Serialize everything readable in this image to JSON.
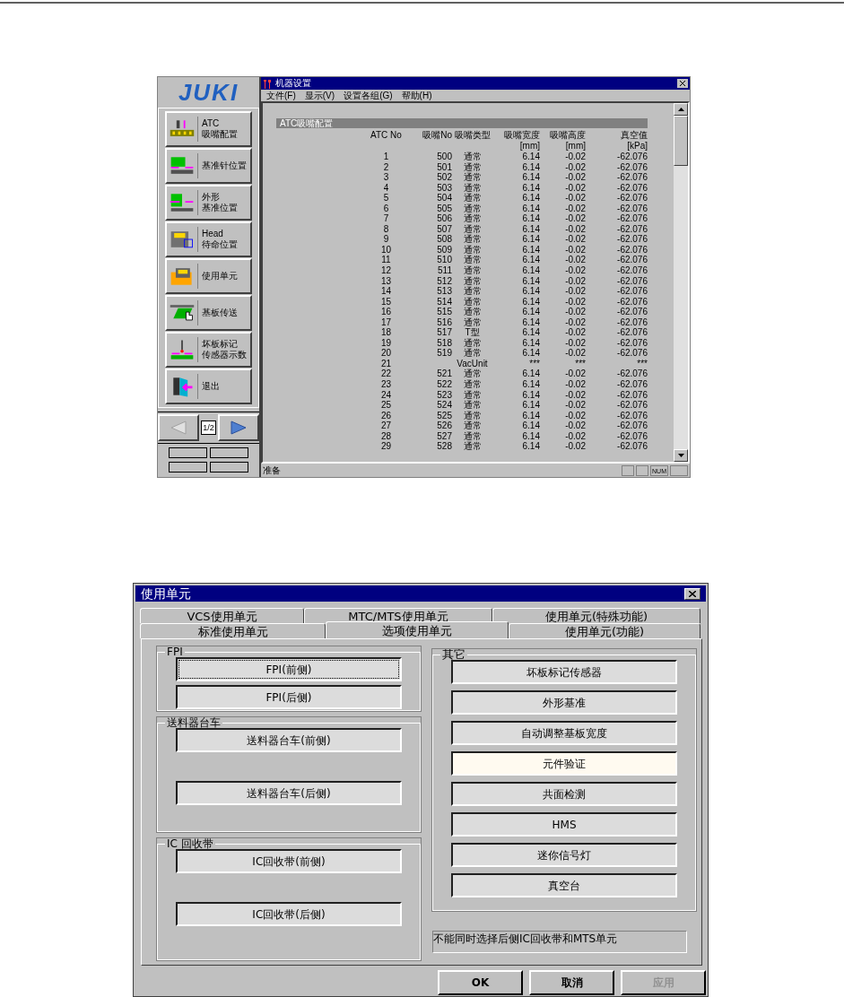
{
  "machine_window": {
    "sidebar": {
      "logo": "JUKI",
      "buttons": [
        {
          "kind": "atc",
          "lines": [
            "ATC",
            "吸嘴配置"
          ]
        },
        {
          "kind": "pin",
          "lines": [
            "基准针位置"
          ]
        },
        {
          "kind": "outline",
          "lines": [
            "外形",
            "基准位置"
          ]
        },
        {
          "kind": "head",
          "lines": [
            "Head",
            "待命位置"
          ]
        },
        {
          "kind": "unit",
          "lines": [
            "使用单元"
          ]
        },
        {
          "kind": "transfer",
          "lines": [
            "基板传送"
          ]
        },
        {
          "kind": "badmark",
          "lines": [
            "坏板标记",
            "传感器示数"
          ]
        },
        {
          "kind": "exit",
          "lines": [
            "退出"
          ]
        }
      ],
      "nav": {
        "prev_disabled": true,
        "page": "1/2",
        "next_disabled": false
      }
    },
    "title": "机器设置",
    "menu": [
      "文件(F)",
      "显示(V)",
      "设置各组(G)",
      "帮助(H)"
    ],
    "section": "ATC吸嘴配置",
    "columns": [
      "ATC No",
      "吸嘴No",
      "吸嘴类型",
      "吸嘴宽度",
      "吸嘴高度",
      "真空值"
    ],
    "units": [
      "[mm]",
      "[mm]",
      "[kPa]"
    ],
    "rows": [
      [
        "1",
        "500",
        "通常",
        "6.14",
        "-0.02",
        "-62.076"
      ],
      [
        "2",
        "501",
        "通常",
        "6.14",
        "-0.02",
        "-62.076"
      ],
      [
        "3",
        "502",
        "通常",
        "6.14",
        "-0.02",
        "-62.076"
      ],
      [
        "4",
        "503",
        "通常",
        "6.14",
        "-0.02",
        "-62.076"
      ],
      [
        "5",
        "504",
        "通常",
        "6.14",
        "-0.02",
        "-62.076"
      ],
      [
        "6",
        "505",
        "通常",
        "6.14",
        "-0.02",
        "-62.076"
      ],
      [
        "7",
        "506",
        "通常",
        "6.14",
        "-0.02",
        "-62.076"
      ],
      [
        "8",
        "507",
        "通常",
        "6.14",
        "-0.02",
        "-62.076"
      ],
      [
        "9",
        "508",
        "通常",
        "6.14",
        "-0.02",
        "-62.076"
      ],
      [
        "10",
        "509",
        "通常",
        "6.14",
        "-0.02",
        "-62.076"
      ],
      [
        "11",
        "510",
        "通常",
        "6.14",
        "-0.02",
        "-62.076"
      ],
      [
        "12",
        "511",
        "通常",
        "6.14",
        "-0.02",
        "-62.076"
      ],
      [
        "13",
        "512",
        "通常",
        "6.14",
        "-0.02",
        "-62.076"
      ],
      [
        "14",
        "513",
        "通常",
        "6.14",
        "-0.02",
        "-62.076"
      ],
      [
        "15",
        "514",
        "通常",
        "6.14",
        "-0.02",
        "-62.076"
      ],
      [
        "16",
        "515",
        "通常",
        "6.14",
        "-0.02",
        "-62.076"
      ],
      [
        "17",
        "516",
        "通常",
        "6.14",
        "-0.02",
        "-62.076"
      ],
      [
        "18",
        "517",
        "T型",
        "6.14",
        "-0.02",
        "-62.076"
      ],
      [
        "19",
        "518",
        "通常",
        "6.14",
        "-0.02",
        "-62.076"
      ],
      [
        "20",
        "519",
        "通常",
        "6.14",
        "-0.02",
        "-62.076"
      ],
      [
        "21",
        null,
        "VacUnit",
        "***",
        "***",
        "***"
      ],
      [
        "22",
        "521",
        "通常",
        "6.14",
        "-0.02",
        "-62.076"
      ],
      [
        "23",
        "522",
        "通常",
        "6.14",
        "-0.02",
        "-62.076"
      ],
      [
        "24",
        "523",
        "通常",
        "6.14",
        "-0.02",
        "-62.076"
      ],
      [
        "25",
        "524",
        "通常",
        "6.14",
        "-0.02",
        "-62.076"
      ],
      [
        "26",
        "525",
        "通常",
        "6.14",
        "-0.02",
        "-62.076"
      ],
      [
        "27",
        "526",
        "通常",
        "6.14",
        "-0.02",
        "-62.076"
      ],
      [
        "28",
        "527",
        "通常",
        "6.14",
        "-0.02",
        "-62.076"
      ],
      [
        "29",
        "528",
        "通常",
        "6.14",
        "-0.02",
        "-62.076"
      ]
    ],
    "status_bar": {
      "text": "准备",
      "indicator": "NUM"
    }
  },
  "unit_dialog": {
    "title": "使用单元",
    "tabs_back": [
      {
        "label": "VCS使用单元",
        "selected": false
      },
      {
        "label": "MTC/MTS使用单元",
        "selected": false
      },
      {
        "label": "使用单元(特殊功能)",
        "selected": false
      }
    ],
    "tabs_front": [
      {
        "label": "标准使用单元",
        "selected": false
      },
      {
        "label": "选项使用单元",
        "selected": true
      },
      {
        "label": "使用单元(功能)",
        "selected": false
      }
    ],
    "left_groups": [
      {
        "title": "FPI",
        "buttons": [
          {
            "label": "FPI(前侧)",
            "focused": true
          },
          {
            "label": "FPI(后侧)",
            "focused": false
          }
        ]
      },
      {
        "title": "送料器台车",
        "buttons": [
          {
            "label": "送料器台车(前侧)",
            "focused": false
          },
          {
            "label": "送料器台车(后侧)",
            "focused": false
          }
        ]
      },
      {
        "title": "IC 回收带",
        "buttons": [
          {
            "label": "IC回收带(前侧)",
            "focused": false
          },
          {
            "label": "IC回收带(后侧)",
            "focused": false
          }
        ]
      }
    ],
    "other_group": {
      "title": "其它",
      "buttons": [
        {
          "label": "坏板标记传感器",
          "on": false
        },
        {
          "label": "外形基准",
          "on": false
        },
        {
          "label": "自动调整基板宽度",
          "on": false
        },
        {
          "label": "元件验证",
          "on": true
        },
        {
          "label": "共面检测",
          "on": false
        },
        {
          "label": "HMS",
          "on": false
        },
        {
          "label": "迷你信号灯",
          "on": false
        },
        {
          "label": "真空台",
          "on": false
        }
      ]
    },
    "message": "不能同时选择后侧IC回收带和MTS单元",
    "buttons": [
      {
        "label": "OK",
        "disabled": false
      },
      {
        "label": "取消",
        "disabled": false
      },
      {
        "label": "应用",
        "disabled": true
      }
    ]
  }
}
